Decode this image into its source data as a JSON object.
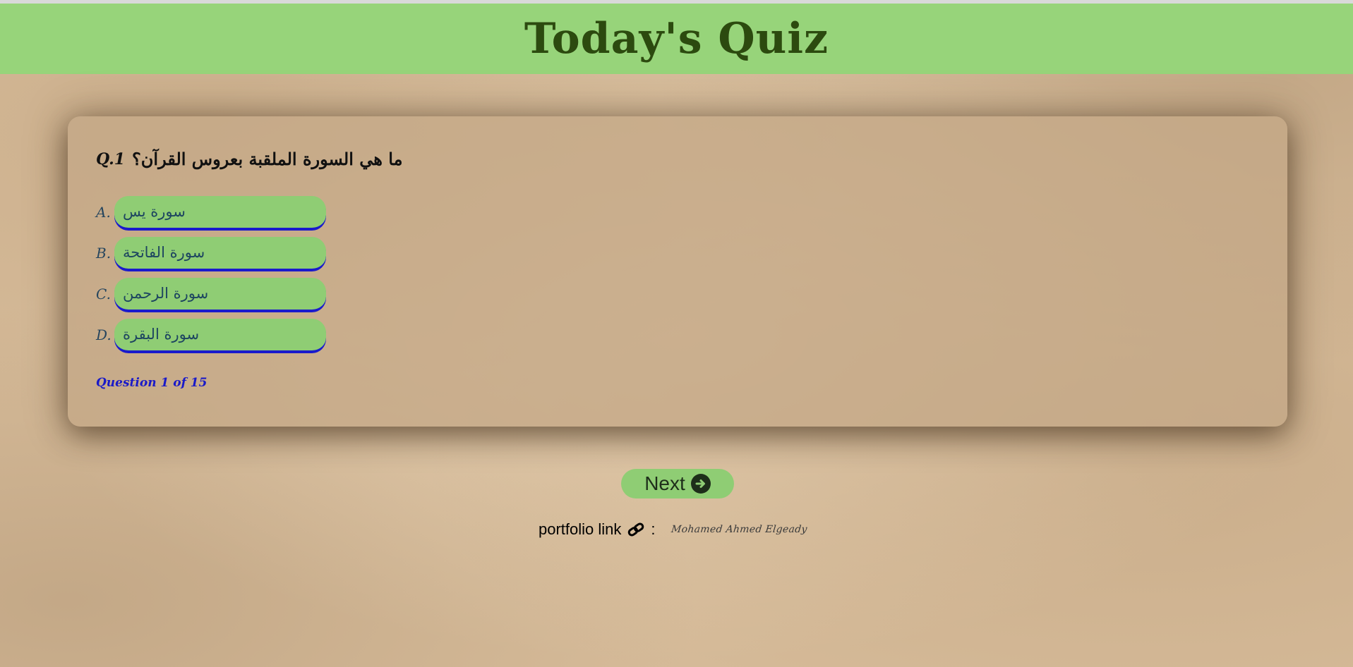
{
  "header": {
    "title": "Today's Quiz"
  },
  "quiz": {
    "question_number": "Q.1",
    "question_text": "ما هي السورة الملقبة بعروس القرآن؟",
    "options": [
      {
        "letter": "A.",
        "text": "سورة يس"
      },
      {
        "letter": "B.",
        "text": "سورة الفاتحة"
      },
      {
        "letter": "C.",
        "text": "سورة الرحمن"
      },
      {
        "letter": "D.",
        "text": "سورة البقرة"
      }
    ],
    "progress": "Question 1 of 15"
  },
  "next_button": {
    "label": "Next",
    "icon": "arrow-circle-right-icon"
  },
  "footer": {
    "portfolio_label": "portfolio link",
    "separator": ":",
    "link_icon": "link-icon",
    "author": "Mohamed Ahmed Elgeady"
  },
  "colors": {
    "header_bg": "#97d47a",
    "header_text": "#2c4a0f",
    "option_bg": "#8fcd74",
    "option_border": "#1a1acc",
    "progress_text": "#1a1ac8",
    "page_bg": "#d6bb99"
  }
}
